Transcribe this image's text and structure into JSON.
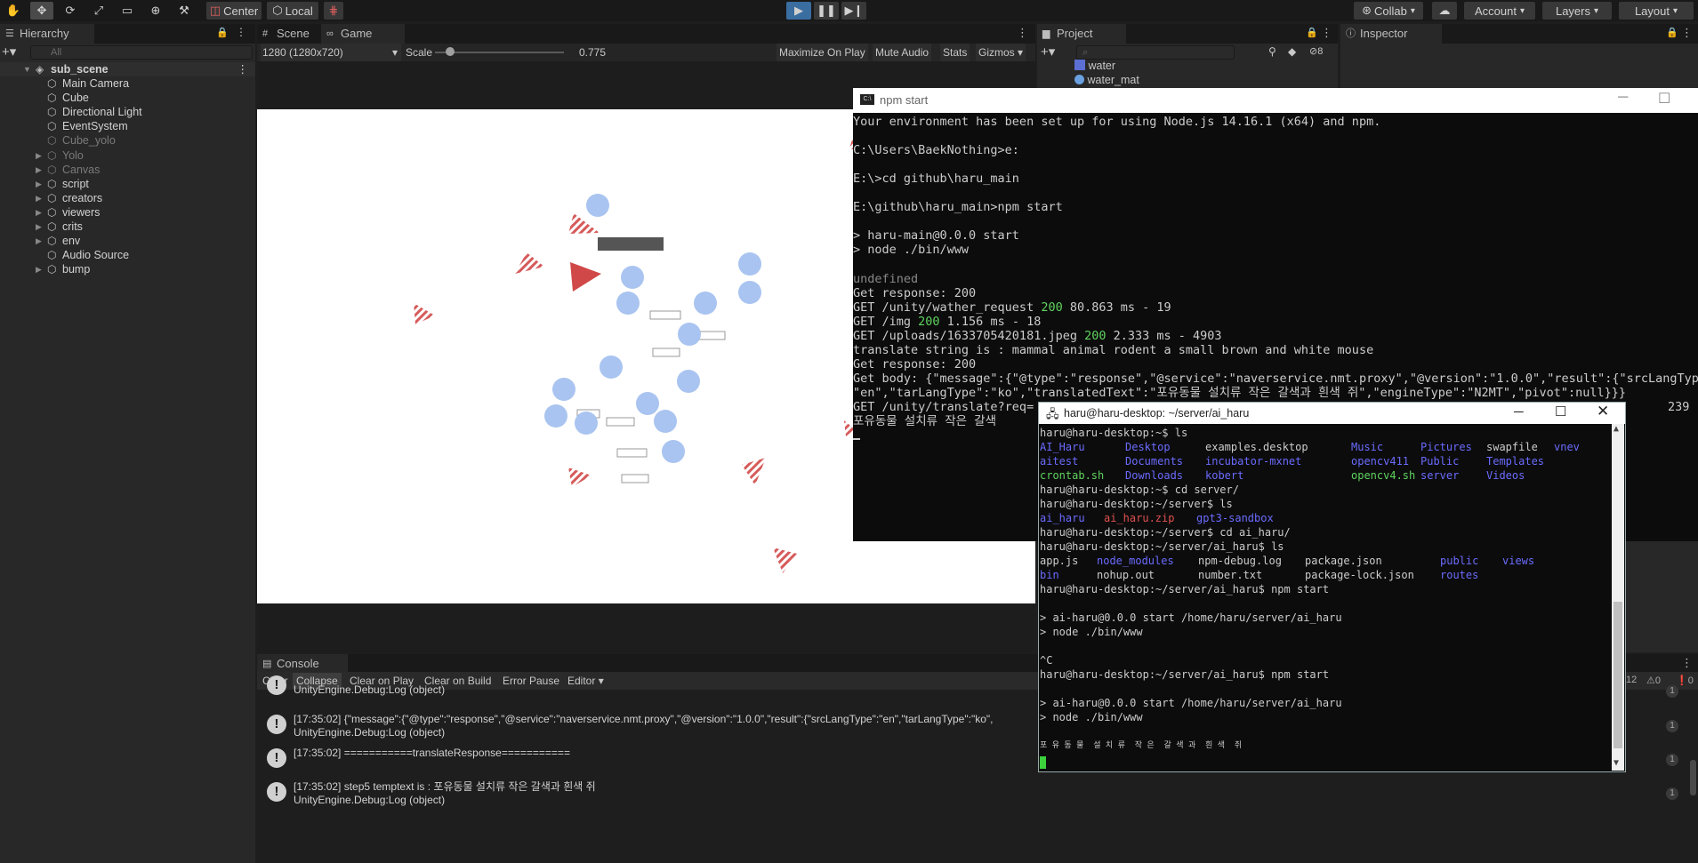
{
  "toolbar": {
    "center_label": "Center",
    "local_label": "Local",
    "collab_label": "Collab",
    "account_label": "Account",
    "layers_label": "Layers",
    "layout_label": "Layout"
  },
  "hierarchy": {
    "tab_label": "Hierarchy",
    "search_placeholder": "All",
    "scene_name": "sub_scene",
    "items": [
      {
        "label": "Main Camera"
      },
      {
        "label": "Cube"
      },
      {
        "label": "Directional Light"
      },
      {
        "label": "EventSystem"
      },
      {
        "label": "Cube_yolo"
      },
      {
        "label": "Yolo"
      },
      {
        "label": "Canvas"
      },
      {
        "label": "script"
      },
      {
        "label": "creators"
      },
      {
        "label": "viewers"
      },
      {
        "label": "crits"
      },
      {
        "label": "env"
      },
      {
        "label": "Audio Source"
      },
      {
        "label": "bump"
      }
    ]
  },
  "center_tabs": {
    "scene": "Scene",
    "game": "Game"
  },
  "game_bar": {
    "resolution": "1280 (1280x720)",
    "scale_label": "Scale",
    "scale_value": "0.775",
    "maximize": "Maximize On Play",
    "mute": "Mute Audio",
    "stats": "Stats",
    "gizmos": "Gizmos"
  },
  "project": {
    "tab_label": "Project",
    "items": [
      {
        "label": "water"
      },
      {
        "label": "water_mat"
      }
    ],
    "hidden_count": "8"
  },
  "inspector": {
    "tab_label": "Inspector"
  },
  "npm_window": {
    "title": "npm start",
    "lines": [
      "Your environment has been set up for using Node.js 14.16.1 (x64) and npm.",
      "",
      "C:\\Users\\BaekNothing>e:",
      "",
      "E:\\>cd github\\haru_main",
      "",
      "E:\\github\\haru_main>npm start",
      "",
      "> haru-main@0.0.0 start",
      "> node ./bin/www",
      "",
      "undefined",
      "Get response: 200",
      "GET /unity/wather_request 200 80.863 ms - 19",
      "GET /img 200 1.156 ms - 18",
      "GET /uploads/1633705420181.jpeg 200 2.333 ms - 4903",
      "translate string is : mammal animal rodent a small brown and white mouse",
      "Get response: 200",
      "Get body: {\"message\":{\"@type\":\"response\",\"@service\":\"naverservice.nmt.proxy\",\"@version\":\"1.0.0\",\"result\":{\"srcLangType\":",
      "\"en\",\"tarLangType\":\"ko\",\"translatedText\":\"포유동물 설치류 작은 갈색과 흰색 쥐\",\"engineType\":\"N2MT\",\"pivot\":null}}}",
      "GET /unity/translate?req=",
      "포유동물 설치류 작은 갈색"
    ],
    "tail_value": "239"
  },
  "ssh_window": {
    "title": "haru@haru-desktop: ~/server/ai_haru",
    "prompt1": "haru@haru-desktop:~$ ls",
    "ls_home": [
      [
        {
          "t": "AI_Haru",
          "c": "blue"
        },
        {
          "t": "Desktop",
          "c": "blue"
        },
        {
          "t": "examples.desktop",
          "c": ""
        },
        {
          "t": "Music",
          "c": "blue"
        },
        {
          "t": "Pictures",
          "c": "blue"
        },
        {
          "t": "swapfile",
          "c": ""
        },
        {
          "t": "vnev",
          "c": "blue"
        }
      ],
      [
        {
          "t": "aitest",
          "c": "blue"
        },
        {
          "t": "Documents",
          "c": "blue"
        },
        {
          "t": "incubator-mxnet",
          "c": "blue"
        },
        {
          "t": "opencv411",
          "c": "blue"
        },
        {
          "t": "Public",
          "c": "blue"
        },
        {
          "t": "Templates",
          "c": "blue"
        },
        {
          "t": "",
          "c": ""
        }
      ],
      [
        {
          "t": "crontab.sh",
          "c": "green"
        },
        {
          "t": "Downloads",
          "c": "blue"
        },
        {
          "t": "kobert",
          "c": "blue"
        },
        {
          "t": "opencv4.sh",
          "c": "green"
        },
        {
          "t": "server",
          "c": "blue"
        },
        {
          "t": "Videos",
          "c": "blue"
        },
        {
          "t": "",
          "c": ""
        }
      ]
    ],
    "cmd_cd_server": "haru@haru-desktop:~$ cd server/",
    "cmd_ls_server": "haru@haru-desktop:~/server$ ls",
    "ls_server": [
      {
        "t": "ai_haru",
        "c": "blue"
      },
      {
        "t": "ai_haru.zip",
        "c": "red"
      },
      {
        "t": "gpt3-sandbox",
        "c": "blue"
      }
    ],
    "cmd_cd_ai": "haru@haru-desktop:~/server$ cd ai_haru/",
    "cmd_ls_ai": "haru@haru-desktop:~/server/ai_haru$ ls",
    "ls_ai": [
      [
        {
          "t": "app.js",
          "c": ""
        },
        {
          "t": "node_modules",
          "c": "blue"
        },
        {
          "t": "npm-debug.log",
          "c": ""
        },
        {
          "t": "package.json",
          "c": ""
        },
        {
          "t": "public",
          "c": "blue"
        },
        {
          "t": "views",
          "c": "blue"
        }
      ],
      [
        {
          "t": "bin",
          "c": "blue"
        },
        {
          "t": "nohup.out",
          "c": ""
        },
        {
          "t": "number.txt",
          "c": ""
        },
        {
          "t": "package-lock.json",
          "c": ""
        },
        {
          "t": "routes",
          "c": "blue"
        },
        {
          "t": "",
          "c": ""
        }
      ]
    ],
    "cmd_npm1": "haru@haru-desktop:~/server/ai_haru$ npm start",
    "start1": "> ai-haru@0.0.0 start /home/haru/server/ai_haru",
    "node1": "> node ./bin/www",
    "ctrl_c": "^C",
    "cmd_npm2": "haru@haru-desktop:~/server/ai_haru$ npm start",
    "start2": "> ai-haru@0.0.0 start /home/haru/server/ai_haru",
    "node2": "> node ./bin/www",
    "output": "포 유 동 물  설 치 류  작 은  갈 색 과  흰 색  쥐"
  },
  "console": {
    "tab_label": "Console",
    "buttons": {
      "clear": "Clear",
      "collapse": "Collapse",
      "clear_on_play": "Clear on Play",
      "clear_on_build": "Clear on Build",
      "error_pause": "Error Pause",
      "editor": "Editor"
    },
    "counts": {
      "log": "12",
      "warn": "0",
      "error": "0"
    },
    "entries": [
      {
        "line1": "",
        "line2": "UnityEngine.Debug:Log (object)",
        "count": "1"
      },
      {
        "line1": "[17:35:02] {\"message\":{\"@type\":\"response\",\"@service\":\"naverservice.nmt.proxy\",\"@version\":\"1.0.0\",\"result\":{\"srcLangType\":\"en\",\"tarLangType\":\"ko\",",
        "line2": "UnityEngine.Debug:Log (object)",
        "count": "1"
      },
      {
        "line1": "[17:35:02] ===========translateResponse===========",
        "line2": "",
        "count": "1"
      },
      {
        "line1": "[17:35:02] step5 temptext is : 포유동물 설치류 작은 갈색과 흰색 쥐",
        "line2": "UnityEngine.Debug:Log (object)",
        "count": "1"
      }
    ]
  },
  "colors": {
    "editor_bg": "#282828",
    "play_blue": "#3a6da0",
    "ls_blue": "#6b6bff",
    "ls_green": "#5fd35f",
    "ls_red": "#e05050"
  }
}
